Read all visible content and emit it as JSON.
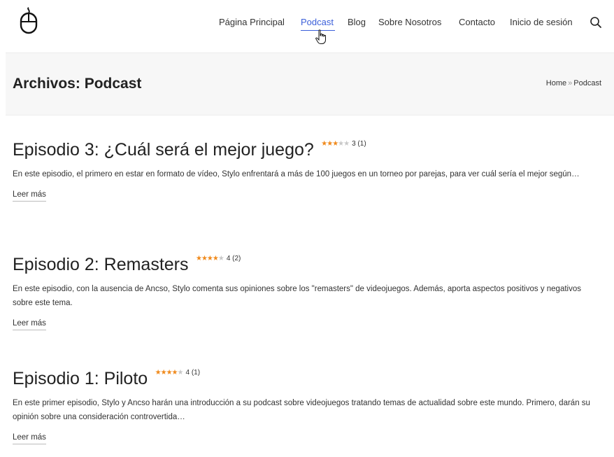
{
  "header": {
    "logo_icon": "mouse-icon",
    "nav": [
      {
        "label": "Página Principal"
      },
      {
        "label": "Podcast"
      },
      {
        "label": "Blog"
      },
      {
        "label": "Sobre Nosotros"
      },
      {
        "label": "Contacto"
      },
      {
        "label": "Inicio de sesión"
      }
    ],
    "active_nav": "Podcast",
    "search_icon": "search-icon",
    "accent_color": "#3b5fd9"
  },
  "banner": {
    "title": "Archivos: Podcast",
    "breadcrumb": {
      "home": "Home",
      "separator": "»",
      "current": "Podcast"
    }
  },
  "posts": [
    {
      "title": "Episodio 3: ¿Cuál será el mejor juego?",
      "stars": 3,
      "rating_text": "3 (1)",
      "excerpt": "En este episodio, el primero en estar en formato de vídeo, Stylo enfrentará a más de 100 juegos en un torneo por parejas, para ver cuál sería el mejor según…",
      "read_more": "Leer más"
    },
    {
      "title": "Episodio 2: Remasters",
      "stars": 4,
      "rating_text": "4 (2)",
      "excerpt": "En este episodio, con la ausencia de Ancso, Stylo comenta sus opiniones sobre los \"remasters\" de videojuegos. Además, aporta aspectos positivos y negativos sobre este tema.",
      "read_more": "Leer más"
    },
    {
      "title": "Episodio 1: Piloto",
      "stars": 4,
      "rating_text": "4 (1)",
      "excerpt": "En este primer episodio, Stylo y Ancso harán una introducción a su podcast sobre videojuegos tratando temas de actualidad sobre este mundo. Primero, darán su opinión sobre una consideración controvertida…",
      "read_more": "Leer más"
    }
  ],
  "star_colors": {
    "filled": "#f08a1c",
    "empty": "#c8c8c8"
  }
}
